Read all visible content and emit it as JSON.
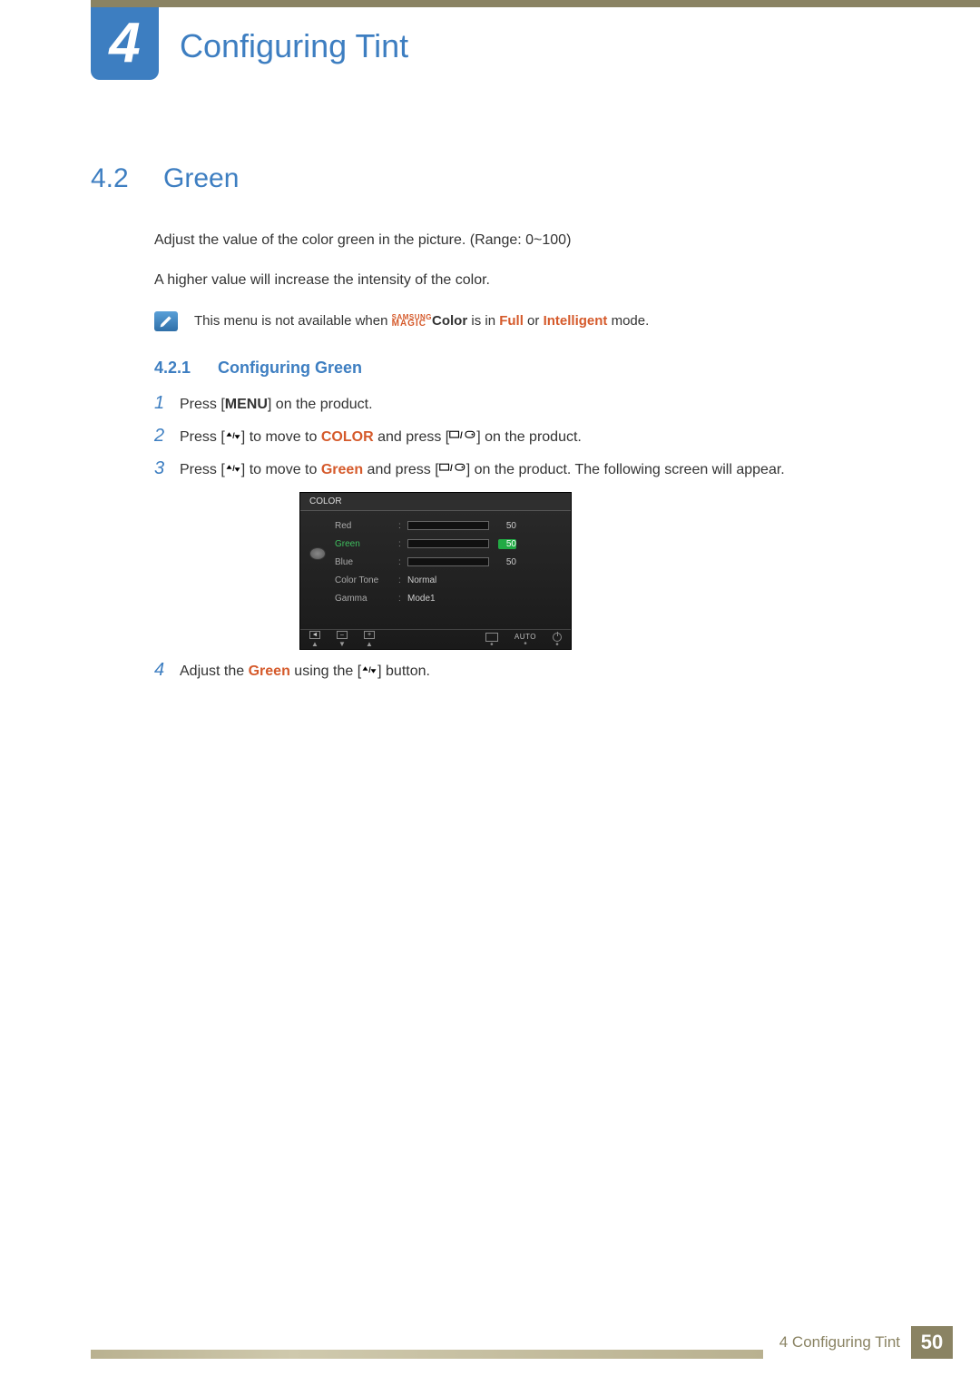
{
  "chapter": {
    "number": "4",
    "title": "Configuring Tint"
  },
  "section": {
    "number": "4.2",
    "title": "Green"
  },
  "paragraphs": {
    "p1": "Adjust the value of the color green in the picture. (Range: 0~100)",
    "p2": "A higher value will increase the intensity of the color."
  },
  "note": {
    "pre": "This menu is not available when ",
    "magic_top": "SAMSUNG",
    "magic_bot": "MAGIC",
    "magic_suffix": "Color",
    "mid1": " is in ",
    "full": "Full",
    "mid2": " or ",
    "intel": "Intelligent",
    "post": " mode."
  },
  "subsection": {
    "number": "4.2.1",
    "title": "Configuring Green"
  },
  "steps": {
    "s1": {
      "num": "1",
      "a": "Press [",
      "menu": "MENU",
      "b": "] on the product."
    },
    "s2": {
      "num": "2",
      "a": "Press [",
      "b": "] to move to ",
      "color": "COLOR",
      "c": " and press [",
      "d": "] on the product."
    },
    "s3": {
      "num": "3",
      "a": "Press [",
      "b": "] to move to ",
      "green": "Green",
      "c": " and press [",
      "d": "] on the product. The following screen will appear."
    },
    "s4": {
      "num": "4",
      "a": "Adjust the ",
      "green": "Green",
      "b": " using the [",
      "c": "] button."
    }
  },
  "osd": {
    "title": "COLOR",
    "rows": {
      "red": {
        "label": "Red",
        "value": "50"
      },
      "green": {
        "label": "Green",
        "value": "50"
      },
      "blue": {
        "label": "Blue",
        "value": "50"
      },
      "tone": {
        "label": "Color Tone",
        "value": "Normal"
      },
      "gamma": {
        "label": "Gamma",
        "value": "Mode1"
      }
    },
    "footer": {
      "minus": "–",
      "plus": "+",
      "auto": "AUTO"
    }
  },
  "footer": {
    "label": "4 Configuring Tint",
    "page": "50"
  }
}
